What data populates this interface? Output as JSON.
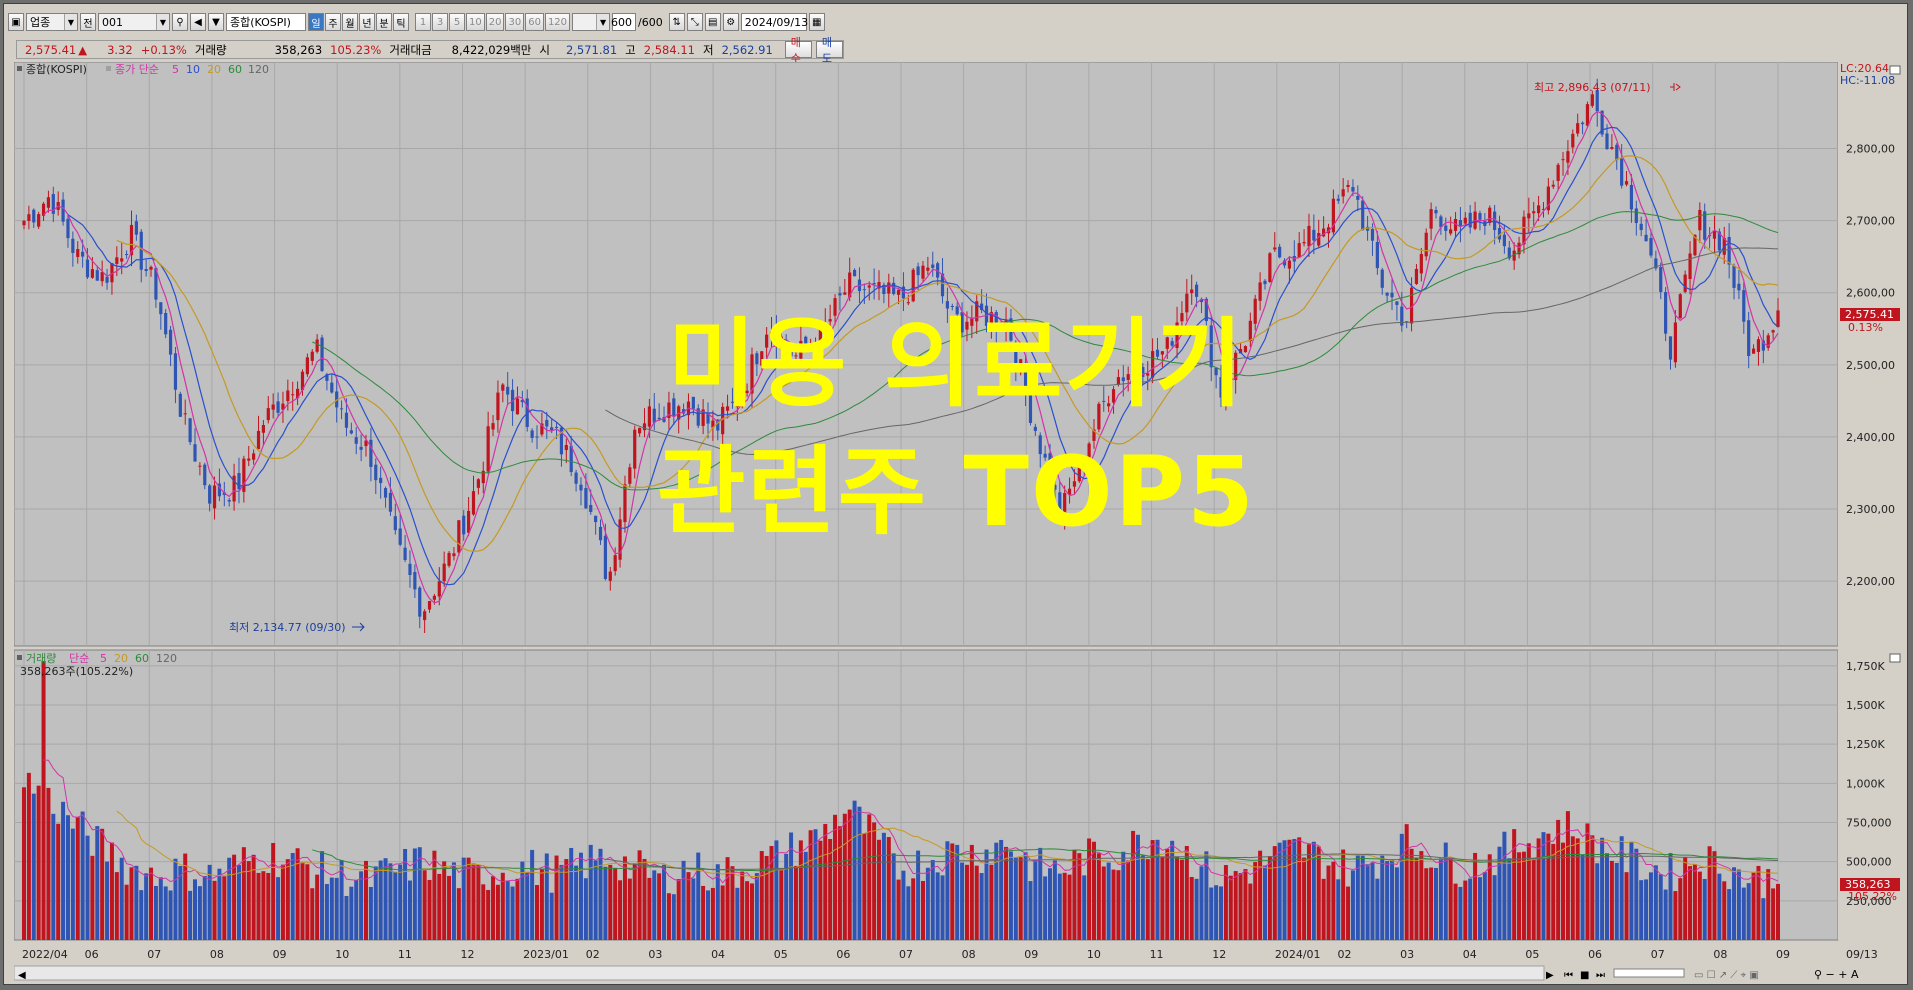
{
  "toolbar": {
    "category": "업종",
    "gubun": "전",
    "code": "001",
    "name": "종합(KOSPI)",
    "period_buttons": [
      "일",
      "주",
      "월",
      "년",
      "분",
      "틱"
    ],
    "active_period": "일",
    "tick_options": [
      "1",
      "3",
      "5",
      "10",
      "20",
      "30",
      "60",
      "120"
    ],
    "count": "600",
    "total": "/600",
    "date": "2024/09/13"
  },
  "quote": {
    "price": "2,575.41",
    "direction_icon": "up-triangle-icon",
    "change": "3.32",
    "change_pct": "+0.13%",
    "volume_label": "거래량",
    "volume": "358,263",
    "volume_ratio": "105.23%",
    "amount_label": "거래대금",
    "amount": "8,422,029백만",
    "open_label": "시",
    "open": "2,571.81",
    "high_label": "고",
    "high": "2,584.11",
    "low_label": "저",
    "low": "2,562.91",
    "buy_label": "매수",
    "sell_label": "매도"
  },
  "price_panel": {
    "name": "종합(KOSPI)",
    "ma_label": "종가 단순",
    "ma_periods": [
      "5",
      "10",
      "20",
      "60",
      "120"
    ],
    "lc_label": "LC:20.64",
    "hc_label": "HC:-11.08",
    "high_annotation": "최고 2,896.43 (07/11)",
    "low_annotation": "최저 2,134.77 (09/30)",
    "current_price_tag": "2,575.41",
    "current_change_tag": "0.13%"
  },
  "volume_panel": {
    "name": "거래량",
    "ma_label": "단순",
    "ma_periods": [
      "5",
      "20",
      "60",
      "120"
    ],
    "current_label": "358,263주(105.22%)",
    "current_volume_tag": "358,263",
    "current_ratio_tag": "105.22%"
  },
  "x_axis": {
    "labels": [
      "2022/04",
      "06",
      "07",
      "08",
      "09",
      "10",
      "11",
      "12",
      "2023/01",
      "02",
      "03",
      "04",
      "05",
      "06",
      "07",
      "08",
      "09",
      "10",
      "11",
      "12",
      "2024/01",
      "02",
      "03",
      "04",
      "05",
      "06",
      "07",
      "08",
      "09"
    ],
    "end_label": "09/13"
  },
  "overlay": {
    "line1": "미용 의료기기",
    "line2": "관련주 TOP5"
  },
  "colors": {
    "up": "#c0141e",
    "down": "#2f55b4",
    "ma5": "#d234a8",
    "ma10": "#2a4fcf",
    "ma20": "#c49a24",
    "ma60": "#2d8a3a",
    "ma120": "#666666",
    "panel_bg": "#c0c0c0",
    "overlay_text": "#ffff00"
  },
  "chart_data": [
    {
      "type": "candlestick",
      "title": "종합(KOSPI)",
      "y_ticks": [
        2200,
        2300,
        2400,
        2500,
        2600,
        2700,
        2800
      ],
      "ylim": [
        2110,
        2920
      ],
      "grid": true,
      "x": [
        "2022/04",
        "06",
        "07",
        "08",
        "09",
        "10",
        "11",
        "12",
        "2023/01",
        "02",
        "03",
        "04",
        "05",
        "06",
        "07",
        "08",
        "09",
        "10",
        "11",
        "12",
        "2024/01",
        "02",
        "03",
        "04",
        "05",
        "06",
        "07",
        "08",
        "09"
      ],
      "close_path": [
        2700,
        2735,
        2650,
        2620,
        2680,
        2600,
        2420,
        2320,
        2330,
        2420,
        2470,
        2520,
        2420,
        2380,
        2250,
        2160,
        2230,
        2330,
        2470,
        2420,
        2400,
        2340,
        2200,
        2420,
        2440,
        2450,
        2410,
        2460,
        2560,
        2510,
        2540,
        2610,
        2600,
        2590,
        2640,
        2560,
        2570,
        2560,
        2420,
        2290,
        2390,
        2480,
        2500,
        2520,
        2630,
        2460,
        2540,
        2650,
        2660,
        2700,
        2750,
        2620,
        2560,
        2720,
        2680,
        2710,
        2660,
        2720,
        2800,
        2870,
        2780,
        2680,
        2520,
        2700,
        2670,
        2510,
        2575
      ],
      "high": 2896.43,
      "high_date": "07/11",
      "low": 2134.77,
      "low_date": "09/30",
      "last": 2575.41,
      "last_change_pct": 0.13
    },
    {
      "type": "bar",
      "title": "거래량",
      "y_ticks": [
        "250,000",
        "500,000",
        "750,000",
        "1,000K",
        "1,250K",
        "1,500K",
        "1,750K"
      ],
      "ylim": [
        0,
        1800
      ],
      "unit": "K",
      "levels": [
        1000,
        860,
        700,
        560,
        430,
        380,
        420,
        380,
        450,
        520,
        480,
        420,
        380,
        360,
        420,
        480,
        400,
        380,
        420,
        440,
        400,
        460,
        500,
        430,
        360,
        440,
        380,
        420,
        480,
        560,
        640,
        820,
        620,
        420,
        480,
        540,
        520,
        600,
        440,
        420,
        500,
        520,
        600,
        640,
        480,
        360,
        420,
        500,
        560,
        480,
        420,
        500,
        600,
        520,
        440,
        480,
        560,
        640,
        700,
        600,
        520,
        440,
        400,
        500,
        440,
        360,
        358
      ]
    }
  ]
}
